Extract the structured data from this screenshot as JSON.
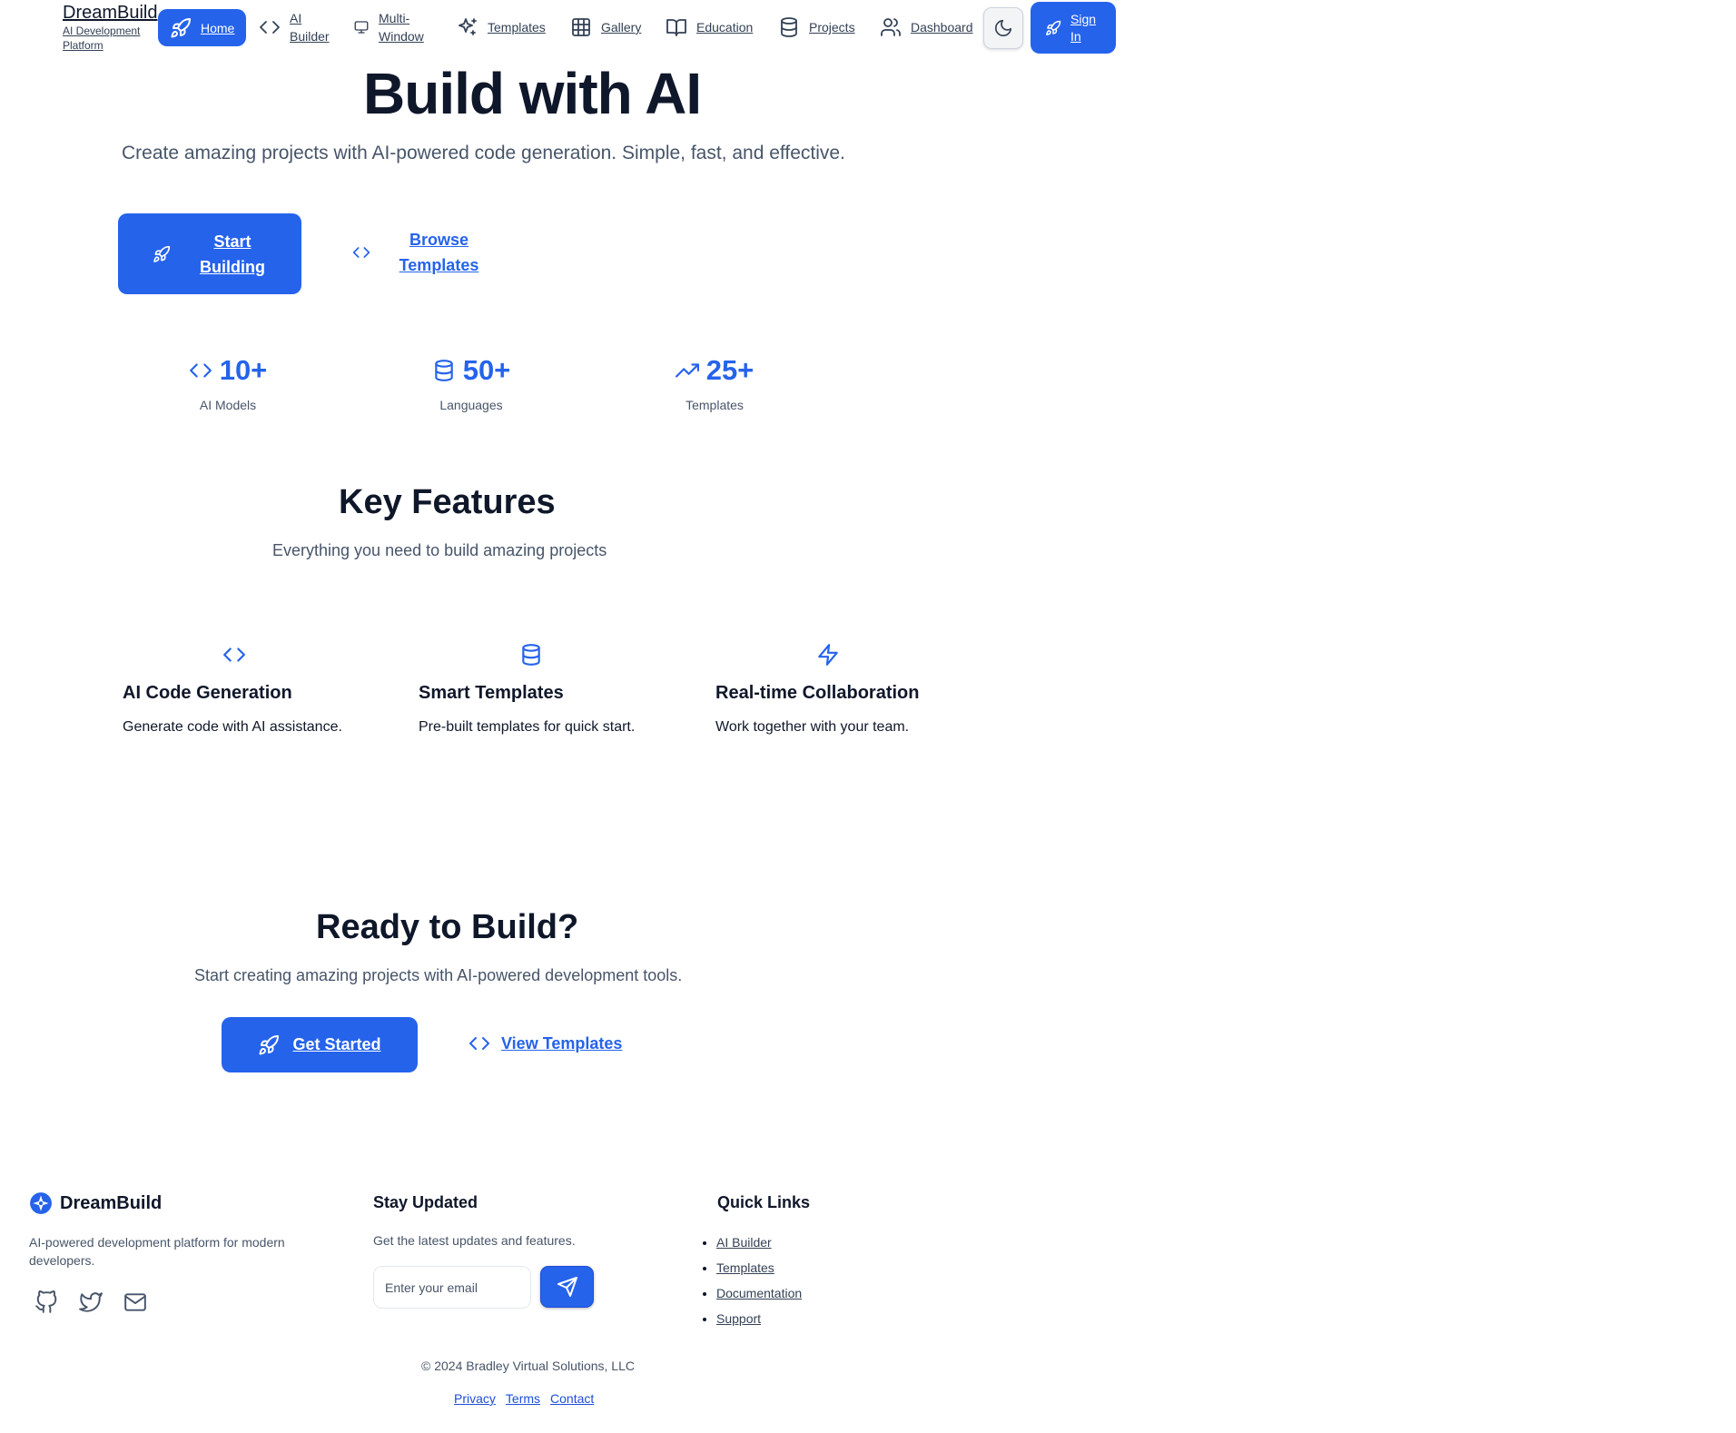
{
  "header": {
    "brand_name": "DreamBuild",
    "brand_tagline": "AI Development Platform",
    "nav": [
      {
        "label": "Home",
        "icon": "rocket-icon",
        "active": true
      },
      {
        "label": "AI Builder",
        "icon": "code-icon"
      },
      {
        "label": "Multi-Window",
        "icon": "monitor-icon"
      },
      {
        "label": "Templates",
        "icon": "sparkles-icon"
      },
      {
        "label": "Gallery",
        "icon": "grid-icon"
      },
      {
        "label": "Education",
        "icon": "book-icon"
      },
      {
        "label": "Projects",
        "icon": "database-icon"
      },
      {
        "label": "Dashboard",
        "icon": "users-icon"
      }
    ],
    "theme_toggle_icon": "moon-icon",
    "signin_label": "Sign In"
  },
  "hero": {
    "title": "Build with AI",
    "subtitle": "Create amazing projects with AI-powered code generation. Simple, fast, and effective.",
    "primary_cta": "Start Building",
    "secondary_cta": "Browse Templates"
  },
  "stats": [
    {
      "value": "10+",
      "label": "AI Models",
      "icon": "code-icon"
    },
    {
      "value": "50+",
      "label": "Languages",
      "icon": "database-icon"
    },
    {
      "value": "25+",
      "label": "Templates",
      "icon": "trending-up-icon"
    }
  ],
  "features": {
    "title": "Key Features",
    "subtitle": "Everything you need to build amazing projects",
    "items": [
      {
        "title": "AI Code Generation",
        "description": "Generate code with AI assistance.",
        "icon": "code-icon"
      },
      {
        "title": "Smart Templates",
        "description": "Pre-built templates for quick start.",
        "icon": "database-icon"
      },
      {
        "title": "Real-time Collaboration",
        "description": "Work together with your team.",
        "icon": "zap-icon"
      }
    ]
  },
  "cta": {
    "title": "Ready to Build?",
    "subtitle": "Start creating amazing projects with AI-powered development tools.",
    "primary": "Get Started",
    "secondary": "View Templates"
  },
  "footer": {
    "brand_name": "DreamBuild",
    "description": "AI-powered development platform for modern developers.",
    "social": [
      "github-icon",
      "twitter-icon",
      "mail-icon"
    ],
    "newsletter_title": "Stay Updated",
    "newsletter_text": "Get the latest updates and features.",
    "email_placeholder": "Enter your email",
    "quick_links_title": "Quick Links",
    "quick_links": [
      "AI Builder",
      "Templates",
      "Documentation",
      "Support"
    ],
    "copyright": "© 2024 Bradley Virtual Solutions, LLC",
    "legal": [
      "Privacy",
      "Terms",
      "Contact"
    ]
  },
  "colors": {
    "accent": "#2563eb",
    "text": "#0f172a",
    "muted": "#475569"
  }
}
